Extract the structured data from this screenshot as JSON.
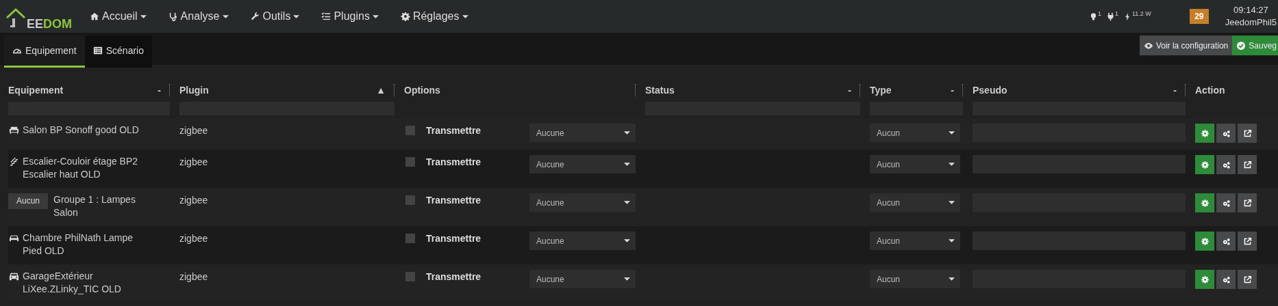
{
  "navbar": {
    "logo": [
      "EE",
      "DOM"
    ],
    "menus": [
      {
        "label": "Accueil"
      },
      {
        "label": "Analyse"
      },
      {
        "label": "Outils"
      },
      {
        "label": "Plugins"
      },
      {
        "label": "Réglages"
      }
    ],
    "indicators": [
      {
        "value": "1"
      },
      {
        "value": "1"
      },
      {
        "value": "11.2 W"
      }
    ],
    "badge": "29",
    "time": "09:14:27",
    "user": "JeedomPhil5"
  },
  "tabs": [
    {
      "label": "Equipement",
      "selected": true
    },
    {
      "label": "Scénario",
      "selected": false
    }
  ],
  "buttons": [
    {
      "label": "Voir la configuration",
      "kind": "view"
    },
    {
      "label": "Sauveg",
      "kind": "save"
    }
  ],
  "table": {
    "columns": [
      {
        "label": "Equipement",
        "sort": "-",
        "filter": true
      },
      {
        "label": "Plugin",
        "sort": "▲",
        "filter": true
      },
      {
        "label": "Options",
        "filter": false
      },
      {
        "label": "Status",
        "sort": "-",
        "filter": true
      },
      {
        "label": "Type",
        "sort": "-",
        "filter": true
      },
      {
        "label": "Pseudo",
        "sort": "-",
        "filter": true
      },
      {
        "label": "Action",
        "filter": false
      }
    ],
    "rows": [
      {
        "name": "Salon BP Sonoff good OLD",
        "plugin": "zigbee",
        "option": "Transmettre",
        "checked": false,
        "option_value": "Aucune",
        "type": "Aucun"
      },
      {
        "name": "Escalier-Couloir étage BP2 Escalier haut OLD",
        "plugin": "zigbee",
        "option": "Transmettre",
        "checked": false,
        "option_value": "Aucune",
        "type": "Aucun"
      },
      {
        "tag": "Aucun",
        "name": "Groupe 1 : Lampes Salon",
        "plugin": "zigbee",
        "option": "Transmettre",
        "checked": false,
        "option_value": "Aucune",
        "type": "Aucun"
      },
      {
        "name": "Chambre PhilNath Lampe Pied OLD",
        "plugin": "zigbee",
        "option": "Transmettre",
        "checked": false,
        "option_value": "Aucune",
        "type": "Aucun"
      },
      {
        "name": "GarageExtérieur LiXee.ZLinky_TIC OLD",
        "plugin": "zigbee",
        "option": "Transmettre",
        "checked": false,
        "option_value": "Aucune",
        "type": "Aucun"
      }
    ]
  }
}
